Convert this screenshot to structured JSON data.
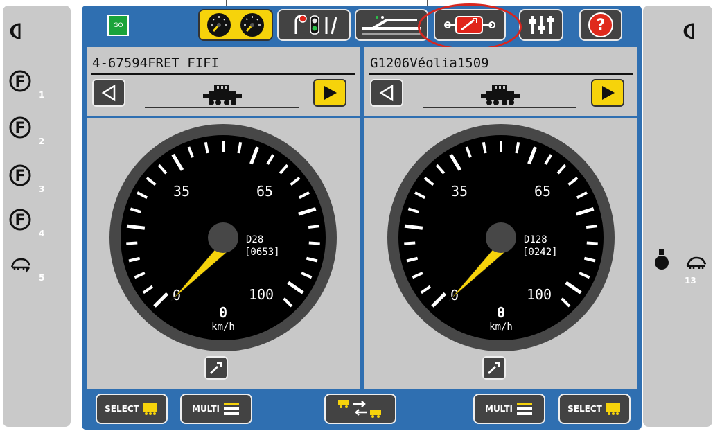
{
  "go_label": "GO",
  "left_functions": [
    {
      "number": "1"
    },
    {
      "number": "2"
    },
    {
      "number": "3"
    },
    {
      "number": "4"
    },
    {
      "number": "5"
    }
  ],
  "right_functions": [
    {
      "number": "13"
    }
  ],
  "toolbar": {
    "icons": [
      "throttle-gauges-icon",
      "signals-icon",
      "track-layout-icon",
      "loco-settings-icon",
      "sliders-icon",
      "help-icon"
    ],
    "help_label": "?",
    "active_index": 0,
    "highlighted_index": 3
  },
  "throttles": [
    {
      "loco_name": "4-67594FRET FIFI",
      "gauge_label_35": "35",
      "gauge_label_65": "65",
      "gauge_label_0": "0",
      "gauge_label_100": "100",
      "address": "D28",
      "address_code": "[0653]",
      "speed": "0",
      "unit": "km/h"
    },
    {
      "loco_name": "G1206Véolia1509",
      "gauge_label_35": "35",
      "gauge_label_65": "65",
      "gauge_label_0": "0",
      "gauge_label_100": "100",
      "address": "D128",
      "address_code": "[0242]",
      "speed": "0",
      "unit": "km/h"
    }
  ],
  "bottom": {
    "select_label": "SELECT",
    "multi_label": "MULTI"
  },
  "colors": {
    "accent_yellow": "#f6d30b",
    "panel_blue": "#2f6fb1",
    "go_green": "#1aa33a",
    "highlight_red": "#d8261f",
    "help_red": "#e02a1c"
  }
}
